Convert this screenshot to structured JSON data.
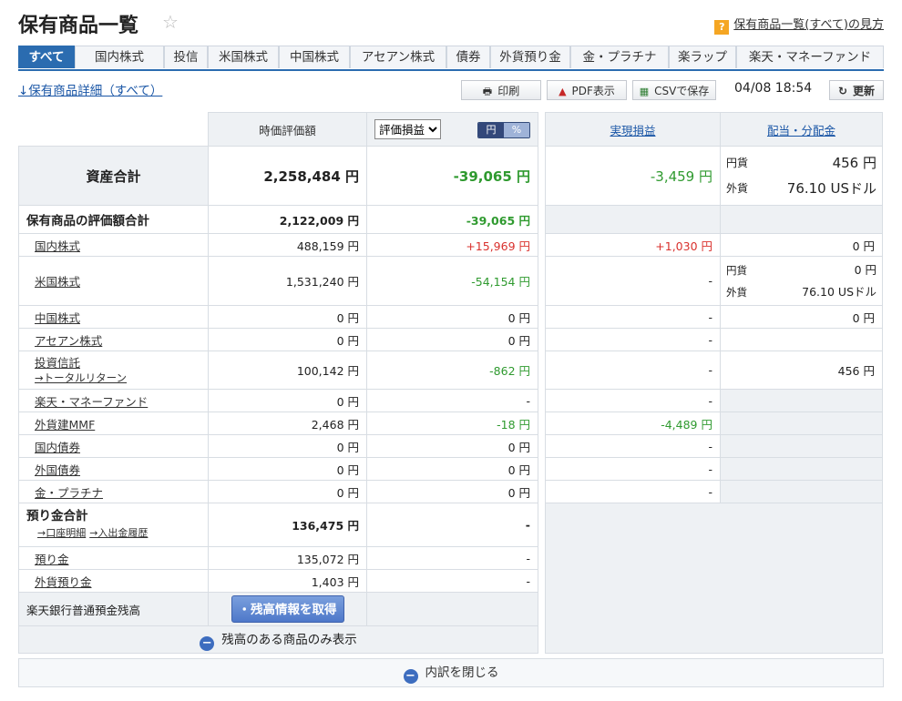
{
  "page": {
    "title": "保有商品一覧",
    "help_link": "保有商品一覧(すべて)の見方",
    "help_icon": "?",
    "detail_link": "↓保有商品詳細（すべて）",
    "timestamp": "04/08 18:54"
  },
  "tabs": [
    "すべて",
    "国内株式",
    "投信",
    "米国株式",
    "中国株式",
    "アセアン株式",
    "債券",
    "外貨預り金",
    "金・プラチナ",
    "楽ラップ",
    "楽天・マネーファンド"
  ],
  "toolbar": {
    "print": "印刷",
    "pdf": "PDF表示",
    "csv": "CSVで保存",
    "refresh": "更新"
  },
  "header": {
    "market_value": "時価評価額",
    "select_value": "評価損益",
    "toggle_yen": "円",
    "toggle_pct": "%",
    "realized": "実現損益",
    "dividend": "配当・分配金"
  },
  "total": {
    "label": "資産合計",
    "value": "2,258,484 円",
    "gain": "-39,065 円",
    "realized": "-3,459 円",
    "div_yen_label": "円貨",
    "div_yen": "456 円",
    "div_fx_label": "外貨",
    "div_fx": "76.10 USドル"
  },
  "holdings_total": {
    "label": "保有商品の評価額合計",
    "value": "2,122,009 円",
    "gain": "-39,065 円"
  },
  "rows": {
    "domestic": {
      "label": "国内株式",
      "value": "488,159 円",
      "gain": "+15,969 円",
      "realized": "+1,030 円",
      "div": "0 円"
    },
    "us": {
      "label": "米国株式",
      "value": "1,531,240 円",
      "gain": "-54,154 円",
      "realized": "-",
      "div_yen_label": "円貨",
      "div_yen": "0 円",
      "div_fx_label": "外貨",
      "div_fx": "76.10 USドル"
    },
    "china": {
      "label": "中国株式",
      "value": "0 円",
      "gain": "0 円",
      "realized": "-",
      "div": "0 円"
    },
    "asean": {
      "label": "アセアン株式",
      "value": "0 円",
      "gain": "0 円",
      "realized": "-"
    },
    "fund": {
      "label": "投資信託",
      "sub": "→トータルリターン",
      "value": "100,142 円",
      "gain": "-862 円",
      "realized": "-",
      "div": "456 円"
    },
    "money_fund": {
      "label": "楽天・マネーファンド",
      "value": "0 円",
      "gain": "-",
      "realized": "-"
    },
    "fx_mmf": {
      "label": "外貨建MMF",
      "value": "2,468 円",
      "gain": "-18 円",
      "realized": "-4,489 円"
    },
    "dom_bond": {
      "label": "国内債券",
      "value": "0 円",
      "gain": "0 円",
      "realized": "-"
    },
    "for_bond": {
      "label": "外国債券",
      "value": "0 円",
      "gain": "0 円",
      "realized": "-"
    },
    "gold": {
      "label": "金・プラチナ",
      "value": "0 円",
      "gain": "0 円",
      "realized": "-"
    }
  },
  "deposits": {
    "label": "預り金合計",
    "link1": "→口座明細",
    "link2": "→入出金履歴",
    "value": "136,475 円",
    "gain": "-",
    "deposit_label": "預り金",
    "deposit_value": "135,072 円",
    "deposit_gain": "-",
    "fx_label": "外貨預り金",
    "fx_value": "1,403 円",
    "fx_gain": "-"
  },
  "bank": {
    "label": "楽天銀行普通預金残高",
    "button": "・残高情報を取得"
  },
  "filter_label": "残高のある商品のみ表示",
  "close_label": "内訳を閉じる",
  "colors": {
    "accent": "#2b6cb0",
    "positive": "#d9312d",
    "negative": "#2f9a2f"
  }
}
